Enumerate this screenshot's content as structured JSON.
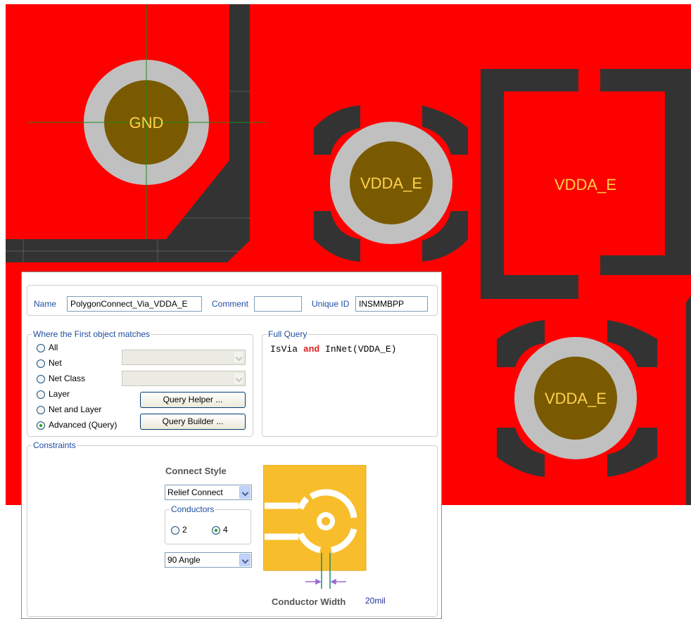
{
  "colors": {
    "copper": "#ff0000",
    "board": "#333333",
    "grid": "#5a5a5a",
    "via_ring": "#c0c0c0",
    "via_hole": "#7a5a00",
    "pad_label": "#ffd24d",
    "relief_fill": "#f7bd2b",
    "keyword": "#e02020",
    "label_blue": "#1f4ea3"
  },
  "pcb": {
    "via_labels": [
      "GND",
      "VDDA_E",
      "VDDA_E"
    ],
    "pad_label": "VDDA_E"
  },
  "rule": {
    "name_label": "Name",
    "name_value": "PolygonConnect_Via_VDDA_E",
    "comment_label": "Comment",
    "comment_value": "",
    "uid_label": "Unique ID",
    "uid_value": "INSMMBPP"
  },
  "match": {
    "legend": "Where the First object matches",
    "options": [
      "All",
      "Net",
      "Net Class",
      "Layer",
      "Net and Layer",
      "Advanced (Query)"
    ],
    "selected": "Advanced (Query)",
    "query_helper": "Query Helper ...",
    "query_builder": "Query Builder ..."
  },
  "full_query": {
    "legend": "Full Query",
    "part1": "IsVia ",
    "keyword": "and",
    "part2": " InNet(VDDA_E)"
  },
  "constraints": {
    "legend": "Constraints",
    "connect_style_label": "Connect Style",
    "connect_style_value": "Relief Connect",
    "conductors_legend": "Conductors",
    "conductor_options": [
      "2",
      "4"
    ],
    "conductor_selected": "4",
    "angle_value": "90 Angle",
    "conductor_width_label": "Conductor Width",
    "conductor_width_value": "20mil"
  }
}
